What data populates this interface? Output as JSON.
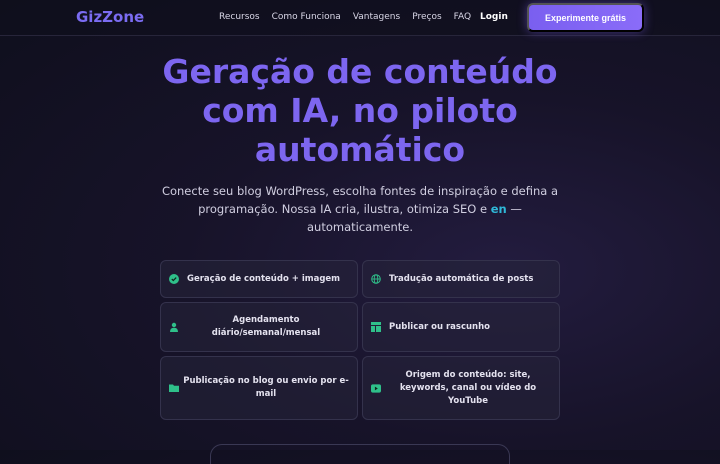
{
  "nav": {
    "logo": "GizZone",
    "links": [
      "Recursos",
      "Como Funciona",
      "Vantagens",
      "Preços",
      "FAQ"
    ],
    "login": "Login",
    "cta": "Experimente grátis"
  },
  "hero": {
    "title_line1": "Geração de conteúdo",
    "title_line2": "com IA, no piloto",
    "title_line3": "automático",
    "subtitle_part1": "Conecte seu blog WordPress, escolha fontes de inspiração e defina a programação. Nossa IA cria, ilustra, otimiza SEO e",
    "subtitle_lang": "en",
    "subtitle_part2": " — automaticamente."
  },
  "features": [
    {
      "icon": "check-circle-icon",
      "label": "Geração de conteúdo + imagem"
    },
    {
      "icon": "globe-icon",
      "label": "Tradução automática de posts"
    },
    {
      "icon": "user-icon",
      "label": "Agendamento diário/semanal/mensal"
    },
    {
      "icon": "layout-icon",
      "label": "Publicar ou rascunho"
    },
    {
      "icon": "folder-icon",
      "label": "Publicação no blog ou envio por e-mail"
    },
    {
      "icon": "youtube-icon",
      "label": "Origem do conteúdo: site, keywords, canal ou vídeo do YouTube"
    }
  ],
  "colors": {
    "accent": "#7b6cf2",
    "icon_green": "#2fc08a",
    "lang_highlight": "#2fb8d8"
  }
}
